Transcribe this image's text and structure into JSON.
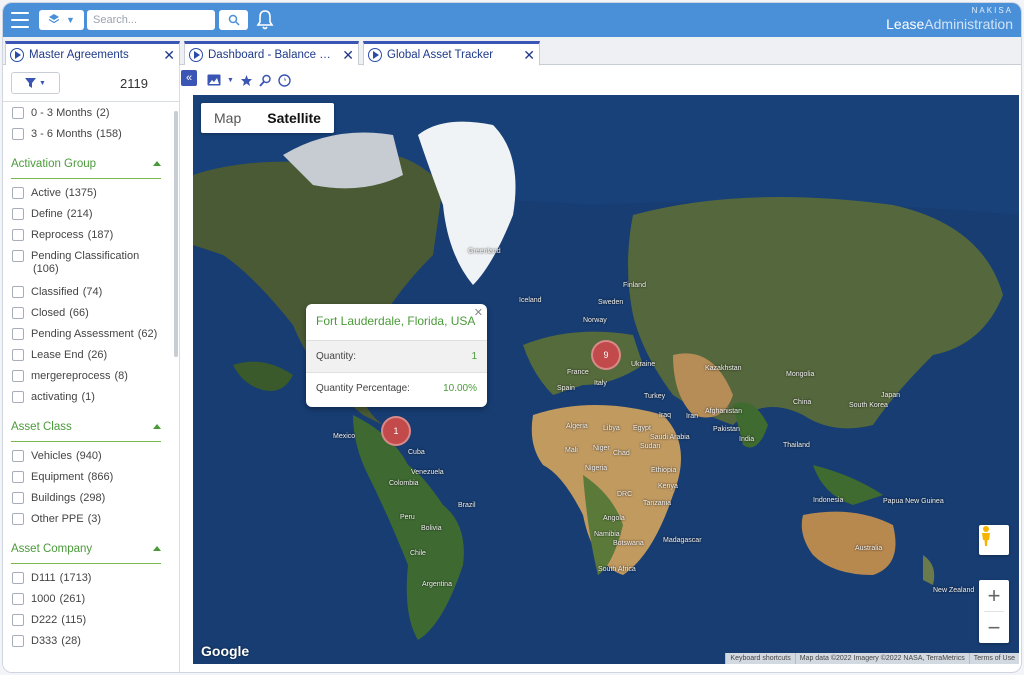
{
  "topbar": {
    "search_placeholder": "Search...",
    "brand_top": "NAKISA",
    "brand_main": "Lease",
    "brand_sub": "Administration"
  },
  "tabs": [
    {
      "label": "Master Agreements"
    },
    {
      "label": "Dashboard - Balance Re..."
    },
    {
      "label": "Global Asset Tracker"
    }
  ],
  "sidebar": {
    "count": "2119",
    "top_items": [
      {
        "label": "0 - 3 Months",
        "count": "(2)"
      },
      {
        "label": "3 - 6 Months",
        "count": "(158)"
      }
    ],
    "activation_group": {
      "title": "Activation Group",
      "items": [
        {
          "label": "Active",
          "count": "(1375)"
        },
        {
          "label": "Define",
          "count": "(214)"
        },
        {
          "label": "Reprocess",
          "count": "(187)"
        },
        {
          "label": "Pending Classification",
          "count": "(106)"
        },
        {
          "label": "Classified",
          "count": "(74)"
        },
        {
          "label": "Closed",
          "count": "(66)"
        },
        {
          "label": "Pending Assessment",
          "count": "(62)"
        },
        {
          "label": "Lease End",
          "count": "(26)"
        },
        {
          "label": "mergereprocess",
          "count": "(8)"
        },
        {
          "label": "activating",
          "count": "(1)"
        }
      ]
    },
    "asset_class": {
      "title": "Asset Class",
      "items": [
        {
          "label": "Vehicles",
          "count": "(940)"
        },
        {
          "label": "Equipment",
          "count": "(866)"
        },
        {
          "label": "Buildings",
          "count": "(298)"
        },
        {
          "label": "Other PPE",
          "count": "(3)"
        }
      ]
    },
    "asset_company": {
      "title": "Asset Company",
      "items": [
        {
          "label": "D111",
          "count": "(1713)"
        },
        {
          "label": "1000",
          "count": "(261)"
        },
        {
          "label": "D222",
          "count": "(115)"
        },
        {
          "label": "D333",
          "count": "(28)"
        }
      ]
    }
  },
  "map": {
    "type_map": "Map",
    "type_satellite": "Satellite",
    "clusters": [
      {
        "count": "9"
      },
      {
        "count": "1"
      }
    ],
    "popup": {
      "title": "Fort Lauderdale, Florida, USA",
      "quantity_label": "Quantity:",
      "quantity_value": "1",
      "percentage_label": "Quantity Percentage:",
      "percentage_value": "10.00%"
    },
    "google": "Google",
    "attribution": {
      "shortcuts": "Keyboard shortcuts",
      "data": "Map data ©2022 Imagery ©2022 NASA, TerraMetrics",
      "terms": "Terms of Use"
    },
    "places": [
      "Greenland",
      "Iceland",
      "Sweden",
      "Finland",
      "Norway",
      "Ukraine",
      "Kazakhstan",
      "Mongolia",
      "China",
      "South Korea",
      "Japan",
      "Afghanistan",
      "Pakistan",
      "Iran",
      "Iraq",
      "Turkey",
      "Saudi Arabia",
      "India",
      "Thailand",
      "Indonesia",
      "Papua New Guinea",
      "Australia",
      "New Zealand",
      "Algeria",
      "Libya",
      "Egypt",
      "Mali",
      "Niger",
      "Chad",
      "Sudan",
      "Nigeria",
      "Ethiopia",
      "DRC",
      "Tanzania",
      "Angola",
      "Namibia",
      "Botswana",
      "South Africa",
      "Madagascar",
      "Kenya",
      "Spain",
      "France",
      "Italy",
      "Mexico",
      "Venezuela",
      "Colombia",
      "Peru",
      "Brazil",
      "Bolivia",
      "Chile",
      "Argentina",
      "Cuba"
    ]
  }
}
